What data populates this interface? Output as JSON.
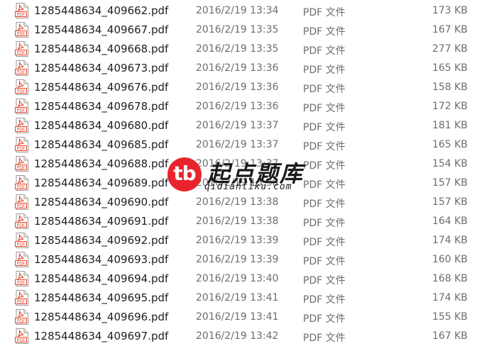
{
  "file_list": {
    "files": [
      {
        "name": "1285448634_409662.pdf",
        "modified": "2016/2/19 13:34",
        "type": "PDF 文件",
        "size": "173 KB"
      },
      {
        "name": "1285448634_409667.pdf",
        "modified": "2016/2/19 13:35",
        "type": "PDF 文件",
        "size": "167 KB"
      },
      {
        "name": "1285448634_409668.pdf",
        "modified": "2016/2/19 13:35",
        "type": "PDF 文件",
        "size": "277 KB"
      },
      {
        "name": "1285448634_409673.pdf",
        "modified": "2016/2/19 13:36",
        "type": "PDF 文件",
        "size": "165 KB"
      },
      {
        "name": "1285448634_409676.pdf",
        "modified": "2016/2/19 13:36",
        "type": "PDF 文件",
        "size": "158 KB"
      },
      {
        "name": "1285448634_409678.pdf",
        "modified": "2016/2/19 13:36",
        "type": "PDF 文件",
        "size": "172 KB"
      },
      {
        "name": "1285448634_409680.pdf",
        "modified": "2016/2/19 13:37",
        "type": "PDF 文件",
        "size": "181 KB"
      },
      {
        "name": "1285448634_409685.pdf",
        "modified": "2016/2/19 13:37",
        "type": "PDF 文件",
        "size": "165 KB"
      },
      {
        "name": "1285448634_409688.pdf",
        "modified": "2016/2/19 13:37",
        "type": "PDF 文件",
        "size": "154 KB"
      },
      {
        "name": "1285448634_409689.pdf",
        "modified": "2016/2/19 13:38",
        "type": "PDF 文件",
        "size": "157 KB"
      },
      {
        "name": "1285448634_409690.pdf",
        "modified": "2016/2/19 13:38",
        "type": "PDF 文件",
        "size": "157 KB"
      },
      {
        "name": "1285448634_409691.pdf",
        "modified": "2016/2/19 13:38",
        "type": "PDF 文件",
        "size": "164 KB"
      },
      {
        "name": "1285448634_409692.pdf",
        "modified": "2016/2/19 13:39",
        "type": "PDF 文件",
        "size": "174 KB"
      },
      {
        "name": "1285448634_409693.pdf",
        "modified": "2016/2/19 13:39",
        "type": "PDF 文件",
        "size": "160 KB"
      },
      {
        "name": "1285448634_409694.pdf",
        "modified": "2016/2/19 13:40",
        "type": "PDF 文件",
        "size": "168 KB"
      },
      {
        "name": "1285448634_409695.pdf",
        "modified": "2016/2/19 13:41",
        "type": "PDF 文件",
        "size": "174 KB"
      },
      {
        "name": "1285448634_409696.pdf",
        "modified": "2016/2/19 13:41",
        "type": "PDF 文件",
        "size": "155 KB"
      },
      {
        "name": "1285448634_409697.pdf",
        "modified": "2016/2/19 13:42",
        "type": "PDF 文件",
        "size": "167 KB"
      }
    ],
    "icon": "pdf-file-icon",
    "icon_label": "PDF"
  },
  "watermark": {
    "badge": "tb",
    "title": "起点题库",
    "domain": "qidiantiku.com"
  },
  "colors": {
    "name_text": "#1e1e1e",
    "meta_text": "#6d6d6d",
    "pdf_icon_accent": "#e8462b",
    "watermark_red": "#e8242e"
  }
}
